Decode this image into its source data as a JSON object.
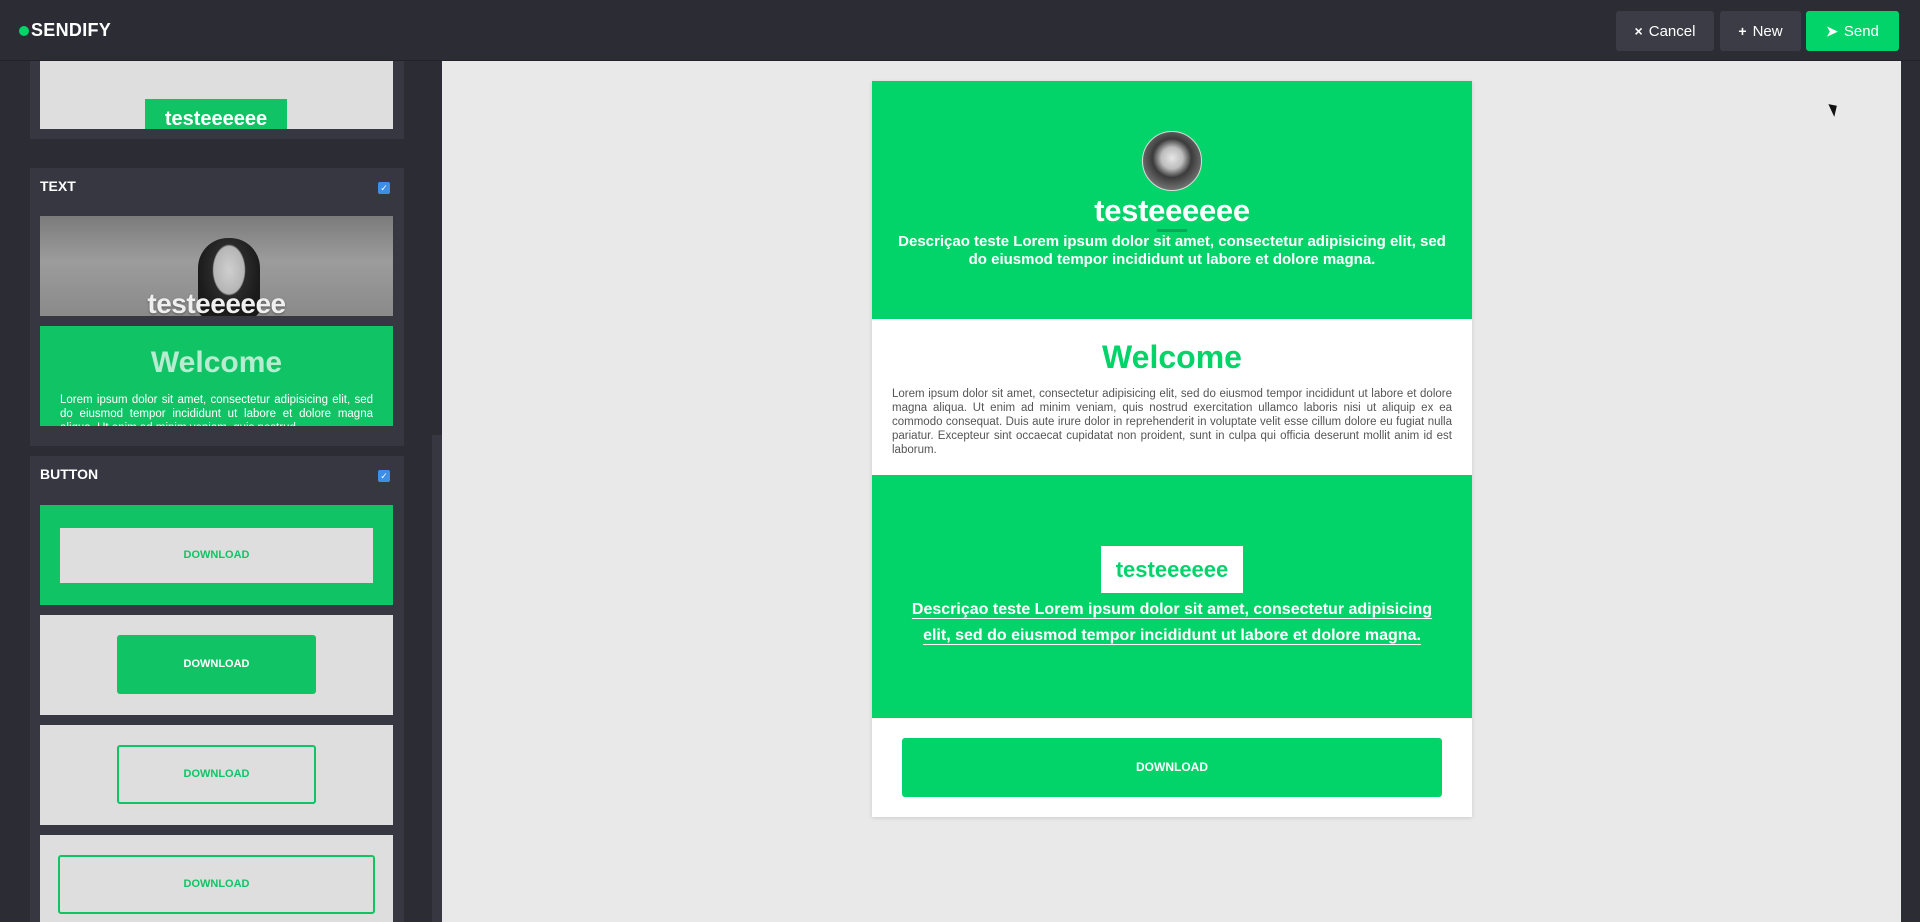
{
  "app": {
    "brand": "SENDIFY"
  },
  "toolbar": {
    "cancel": {
      "icon": "×",
      "label": "Cancel"
    },
    "new": {
      "icon": "+",
      "label": "New"
    },
    "send": {
      "icon": "➤",
      "label": "Send"
    }
  },
  "sidebar": {
    "partial_thumb": {
      "label": "testeeeeee"
    },
    "text_panel": {
      "title": "TEXT",
      "checked": true,
      "photo_caption": "testeeeeee",
      "welcome_title": "Welcome",
      "welcome_body": "Lorem ipsum dolor sit amet, consectetur adipisicing elit, sed do eiusmod tempor incididunt ut labore et dolore magna aliqua. Ut enim ad minim veniam, quis nostrud"
    },
    "button_panel": {
      "title": "BUTTON",
      "checked": true,
      "variants": [
        "DOWNLOAD",
        "DOWNLOAD",
        "DOWNLOAD",
        "DOWNLOAD"
      ]
    }
  },
  "email": {
    "hero": {
      "title": "testeeeeee",
      "description": "Descriçao teste Lorem ipsum dolor sit amet, consectetur adipisicing elit, sed do eiusmod tempor incididunt ut labore et dolore magna."
    },
    "welcome": {
      "title": "Welcome",
      "body": "Lorem ipsum dolor sit amet, consectetur adipisicing elit, sed do eiusmod tempor incididunt ut labore et dolore magna aliqua. Ut enim ad minim veniam, quis nostrud exercitation ullamco laboris nisi ut aliquip ex ea commodo consequat. Duis aute irure dolor in reprehenderit in voluptate velit esse cillum dolore eu fugiat nulla pariatur. Excepteur sint occaecat cupidatat non proident, sunt in culpa qui officia deserunt mollit anim id est laborum."
    },
    "cta": {
      "label": "testeeeeee",
      "description": "Descriçao teste Lorem ipsum dolor sit amet, consectetur adipisicing elit, sed do eiusmod tempor incididunt ut labore et dolore magna."
    },
    "download": {
      "label": "DOWNLOAD"
    }
  },
  "colors": {
    "accent": "#03d46a",
    "accent_dark": "#10c466",
    "topbar": "#2b2c34",
    "panel": "#363740",
    "canvas": "#e9e9e9"
  }
}
